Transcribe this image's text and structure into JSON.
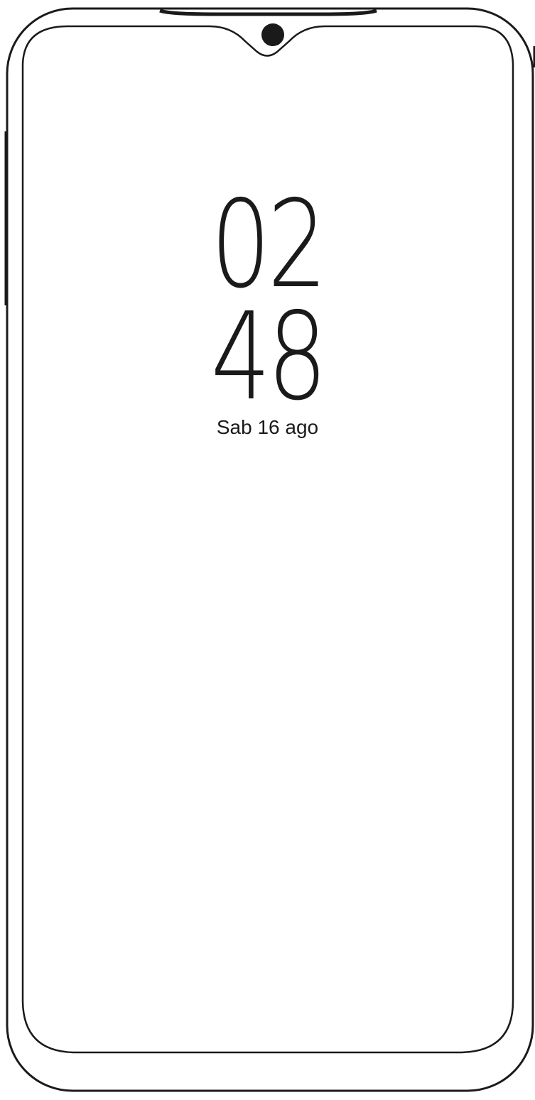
{
  "lockscreen": {
    "clock": {
      "hour": "02",
      "minute": "48"
    },
    "date": "Sab 16 ago"
  },
  "device": {
    "frame_color": "#1a1a1a",
    "screen_color": "#ffffff",
    "icons": [
      "front-camera-icon"
    ]
  }
}
